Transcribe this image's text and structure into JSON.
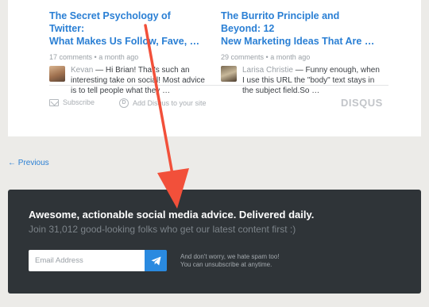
{
  "posts": [
    {
      "title_line1": "The Secret Psychology of Twitter:",
      "title_line2": "What Makes Us Follow, Fave, …",
      "comments": "17 comments",
      "time": "a month ago",
      "author": "Kevan",
      "text_line1": "— Hi Brian! That's such an",
      "text_line2": "interesting take on social! Most advice",
      "text_line3": "is to tell people what they …"
    },
    {
      "title_line1": "The Burrito Principle and Beyond: 12",
      "title_line2": "New Marketing Ideas That Are …",
      "comments": "29 comments",
      "time": "a month ago",
      "author": "Larisa Christie",
      "text_line1": "— Funny enough, when",
      "text_line2": "I use this URL the \"body\" text stays in",
      "text_line3": "the subject field.So …"
    }
  ],
  "meta_separator": "•",
  "disqus_footer": {
    "subscribe": "Subscribe",
    "add": "Add Disqus to your site",
    "add_icon_glyph": "D",
    "brand": "DISQUS"
  },
  "pagination": {
    "previous": "← Previous"
  },
  "newsletter": {
    "headline": "Awesome, actionable social media advice. Delivered daily.",
    "subline": "Join 31,012 good-looking folks who get our latest content first :)",
    "email_placeholder": "Email Address",
    "note_line1": "And don't worry, we hate spam too!",
    "note_line2": "You can unsubscribe at anytime."
  },
  "colors": {
    "link": "#2a7fd4",
    "newsletter_bg": "#2f3438",
    "button": "#2a8ae0",
    "annotation_arrow": "#f2503a"
  }
}
